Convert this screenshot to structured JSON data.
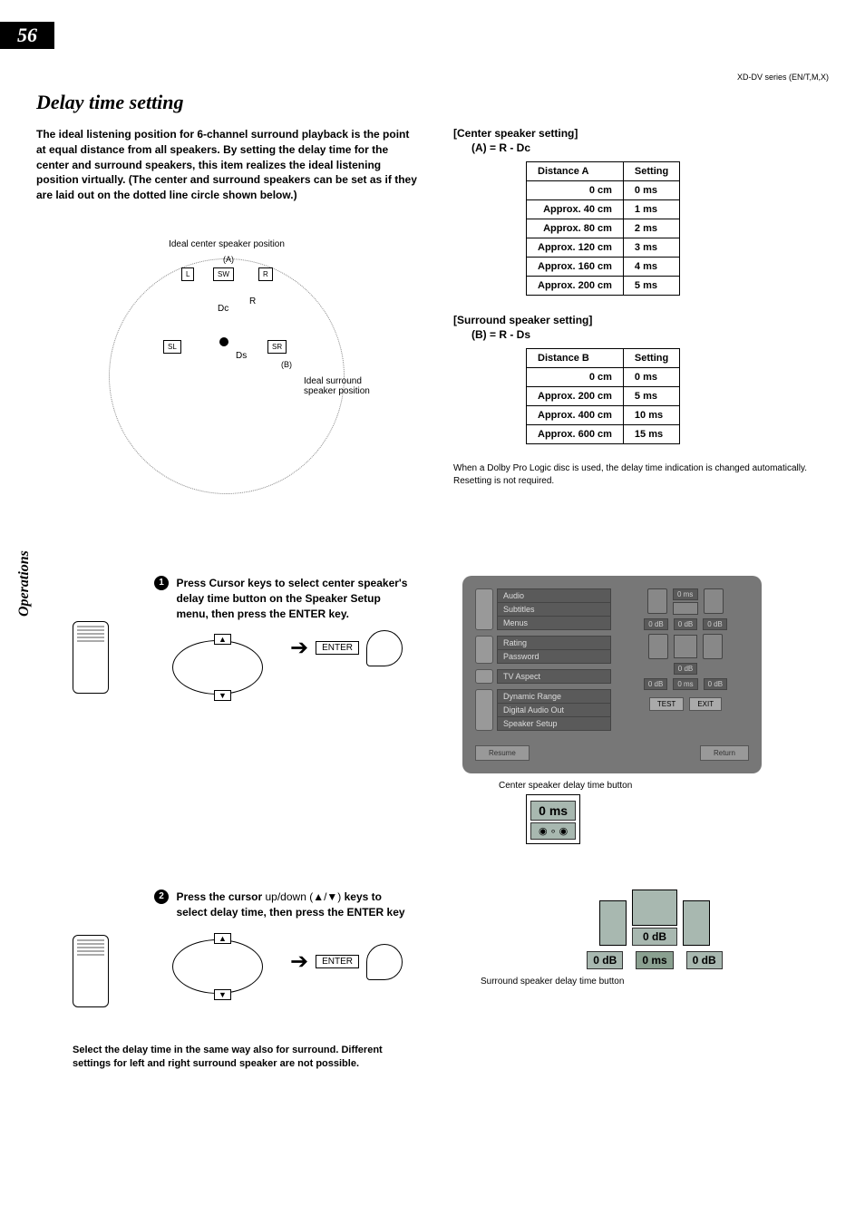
{
  "page_number": "56",
  "header_code": "XD-DV series (EN/T,M,X)",
  "side_label": "Operations",
  "title": "Delay time setting",
  "intro": "The ideal listening position for 6-channel surround playback is the point at equal distance from all speakers.\nBy setting the delay time for the center and surround speakers, this item realizes the ideal listening position virtually. (The center and surround speakers can be set as if they are laid out on the dotted line circle shown below.)",
  "diagram": {
    "ideal_center": "Ideal center speaker position",
    "ideal_surround": "Ideal surround speaker position",
    "labels": {
      "A": "(A)",
      "B": "(B)",
      "R": "R",
      "Dc": "Dc",
      "Ds": "Ds",
      "L": "L",
      "SW": "SW",
      "Rspk": "R",
      "SL": "SL",
      "SR": "SR"
    }
  },
  "center": {
    "heading": "[Center speaker setting]",
    "formula": "(A) = R - Dc",
    "col1": "Distance A",
    "col2": "Setting",
    "rows": [
      {
        "d": "0 cm",
        "s": "0 ms"
      },
      {
        "d": "Approx.   40 cm",
        "s": "1 ms"
      },
      {
        "d": "Approx.   80 cm",
        "s": "2 ms"
      },
      {
        "d": "Approx. 120 cm",
        "s": "3 ms"
      },
      {
        "d": "Approx. 160 cm",
        "s": "4 ms"
      },
      {
        "d": "Approx. 200 cm",
        "s": "5 ms"
      }
    ]
  },
  "surround": {
    "heading": "[Surround speaker setting]",
    "formula": "(B) = R - Ds",
    "col1": "Distance B",
    "col2": "Setting",
    "rows": [
      {
        "d": "0 cm",
        "s": "0 ms"
      },
      {
        "d": "Approx. 200 cm",
        "s": "5 ms"
      },
      {
        "d": "Approx. 400 cm",
        "s": "10 ms"
      },
      {
        "d": "Approx. 600 cm",
        "s": "15 ms"
      }
    ],
    "note": "When a Dolby Pro Logic disc is used, the delay time indication is changed automatically. Resetting is not required."
  },
  "step1": {
    "num": "1",
    "text": "Press Cursor keys to select center speaker's delay time button on the Speaker Setup menu, then press the ENTER key.",
    "enter": "ENTER"
  },
  "step2": {
    "num": "2",
    "text_a": "Press the cursor ",
    "text_b": "up/down (▲/▼)",
    "text_c": " keys to select delay time, then press the ENTER key",
    "enter": "ENTER"
  },
  "osd": {
    "menu1": [
      "Audio",
      "Subtitles",
      "Menus"
    ],
    "menu2": [
      "Rating",
      "Password"
    ],
    "menu3": [
      "TV Aspect"
    ],
    "menu4": [
      "Dynamic Range",
      "Digital Audio Out",
      "Speaker Setup"
    ],
    "top_val": "0 ms",
    "row_vals": [
      "0 dB",
      "0 dB",
      "0 dB"
    ],
    "mid_val": "0 dB",
    "bot_vals": [
      "0 dB",
      "0 ms",
      "0 dB"
    ],
    "test": "TEST",
    "exit": "EXIT",
    "resume": "Resume",
    "return": "Return"
  },
  "caption1": "Center speaker delay time button",
  "closeup1": {
    "val": "0 ms"
  },
  "closeup2": {
    "top": "0 dB",
    "left": "0 dB",
    "mid": "0 ms",
    "right": "0 dB"
  },
  "caption2": "Surround speaker delay time button",
  "bottom_note": "Select the delay time in the same way also for surround. Different settings for left and right surround speaker are not possible."
}
